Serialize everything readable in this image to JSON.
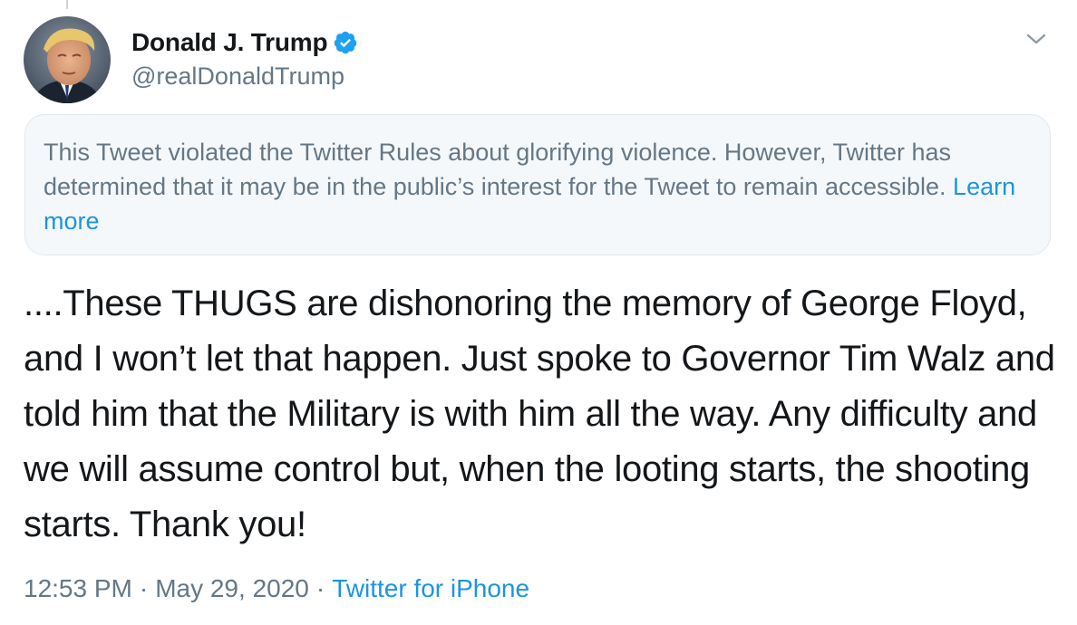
{
  "author": {
    "display_name": "Donald J. Trump",
    "handle": "@realDonaldTrump",
    "verified_icon": "verified-badge-icon",
    "avatar_alt": "profile photo"
  },
  "menu": {
    "icon": "chevron-down-icon"
  },
  "notice": {
    "text": "This Tweet violated the Twitter Rules about glorifying violence. However, Twitter has determined that it may be in the public’s interest for the Tweet to remain accessible.",
    "link_label": "Learn more"
  },
  "tweet": {
    "text": "....These THUGS are dishonoring the memory of George Floyd, and I won’t let that happen. Just spoke to Governor Tim Walz and told him that the Military is with him all the way. Any difficulty and we will assume control but, when the looting starts, the shooting starts. Thank you!"
  },
  "meta": {
    "time": "12:53 PM",
    "date": "May 29, 2020",
    "separator": "·",
    "source": "Twitter for iPhone"
  },
  "colors": {
    "accent": "#1b95e0",
    "secondary_text": "#657786",
    "notice_background": "#f5f8fa",
    "notice_border": "#e1e8ed"
  }
}
